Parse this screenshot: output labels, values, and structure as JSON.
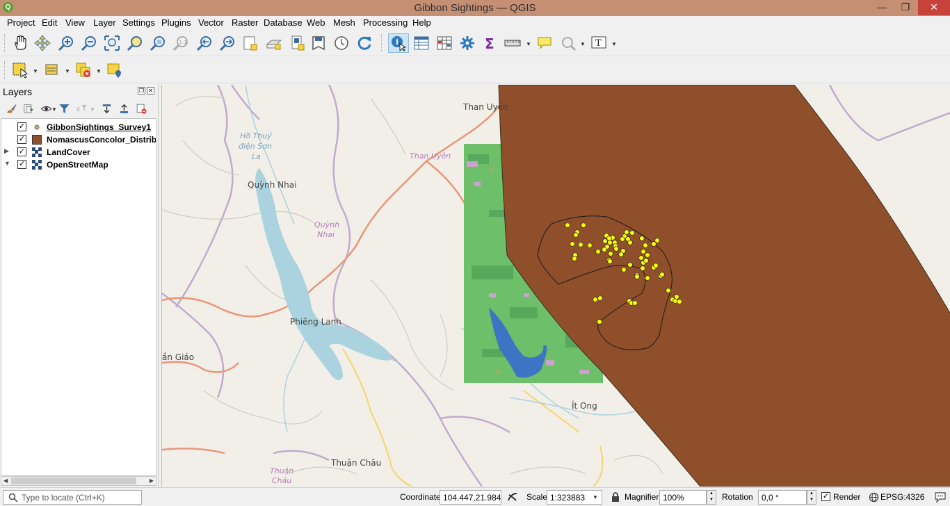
{
  "window": {
    "title": "Gibbon Sightings — QGIS",
    "minimize": "—",
    "restore": "❐",
    "close": "✕"
  },
  "menu": [
    "Project",
    "Edit",
    "View",
    "Layer",
    "Settings",
    "Plugins",
    "Vector",
    "Raster",
    "Database",
    "Web",
    "Mesh",
    "Processing",
    "Help"
  ],
  "toolbar1": {
    "icons": [
      "pan-icon",
      "pan-to-selection-icon",
      "zoom-in-icon",
      "zoom-out-icon",
      "zoom-full-icon",
      "zoom-to-selection-icon",
      "zoom-to-layer-icon",
      "zoom-native-icon",
      "zoom-last-icon",
      "zoom-next-icon",
      "new-bookmark-icon",
      "show-bookmarks-icon",
      "new-map-view-icon",
      "new-3d-view-icon",
      "temporal-controller-icon",
      "refresh-icon",
      "identify-icon",
      "attribute-table-icon",
      "field-calculator-icon",
      "processing-toolbox-icon",
      "statistics-icon",
      "measure-icon",
      "map-tips-icon",
      "zoom-tool-icon",
      "text-annotation-icon"
    ]
  },
  "toolbar2": {
    "icons": [
      "select-features-icon",
      "deselect-icon",
      "select-by-expression-icon",
      "select-by-location-icon"
    ]
  },
  "layers_panel": {
    "title": "Layers",
    "float_button": "❐",
    "close_button": "✕",
    "tools": [
      "open-styling-icon",
      "add-group-icon",
      "manage-visibility-icon",
      "filter-legend-icon",
      "filter-by-expression-icon",
      "expand-all-icon",
      "collapse-all-icon",
      "remove-layer-icon"
    ],
    "layers": [
      {
        "name": "GibbonSightings_Survey1",
        "checked": "✓",
        "expander": "",
        "symbol": "point-symbol-icon",
        "underline": true
      },
      {
        "name": "NomascusConcolor_Distribut",
        "checked": "✓",
        "expander": "",
        "symbol": "polygon-symbol-icon",
        "color": "#8f4f2b"
      },
      {
        "name": "LandCover",
        "checked": "✓",
        "expander": "▶",
        "symbol": "raster-symbol-icon"
      },
      {
        "name": "OpenStreetMap",
        "checked": "✓",
        "expander": "▼",
        "symbol": "raster-symbol-icon"
      }
    ]
  },
  "map": {
    "labels": [
      {
        "text": "Than Uyên",
        "kind": "town"
      },
      {
        "text": "Hồ Thuỷ",
        "kind": "water"
      },
      {
        "text": "điện Sơn",
        "kind": "water"
      },
      {
        "text": "La",
        "kind": "water"
      },
      {
        "text": "Than Uyên",
        "kind": "district"
      },
      {
        "text": "Quỳnh Nhai",
        "kind": "town"
      },
      {
        "text": "Quỳnh",
        "kind": "district"
      },
      {
        "text": "Nhai",
        "kind": "district"
      },
      {
        "text": "Phiêng Lanh",
        "kind": "town"
      },
      {
        "text": "ần Giáo",
        "kind": "town"
      },
      {
        "text": "Ít Ong",
        "kind": "town"
      },
      {
        "text": "Thuận Châu",
        "kind": "town"
      },
      {
        "text": "Thuận",
        "kind": "district"
      },
      {
        "text": "Châu",
        "kind": "district"
      }
    ],
    "colors": {
      "background": "#f2efe9",
      "distribution_fill": "#8f4f2b",
      "landcover": "#6dbf6a",
      "water": "#aad3df",
      "sighting": "#ffff00"
    }
  },
  "statusbar": {
    "locator_placeholder": "Type to locate (Ctrl+K)",
    "coordinate_label": "Coordinate",
    "coordinate_value": "104.447,21.984",
    "scale_label": "Scale",
    "scale_value": "1:323883",
    "magnifier_label": "Magnifier",
    "magnifier_value": "100%",
    "rotation_label": "Rotation",
    "rotation_value": "0,0 °",
    "render_label": "Render",
    "render_checked": "✓",
    "crs": "EPSG:4326"
  }
}
